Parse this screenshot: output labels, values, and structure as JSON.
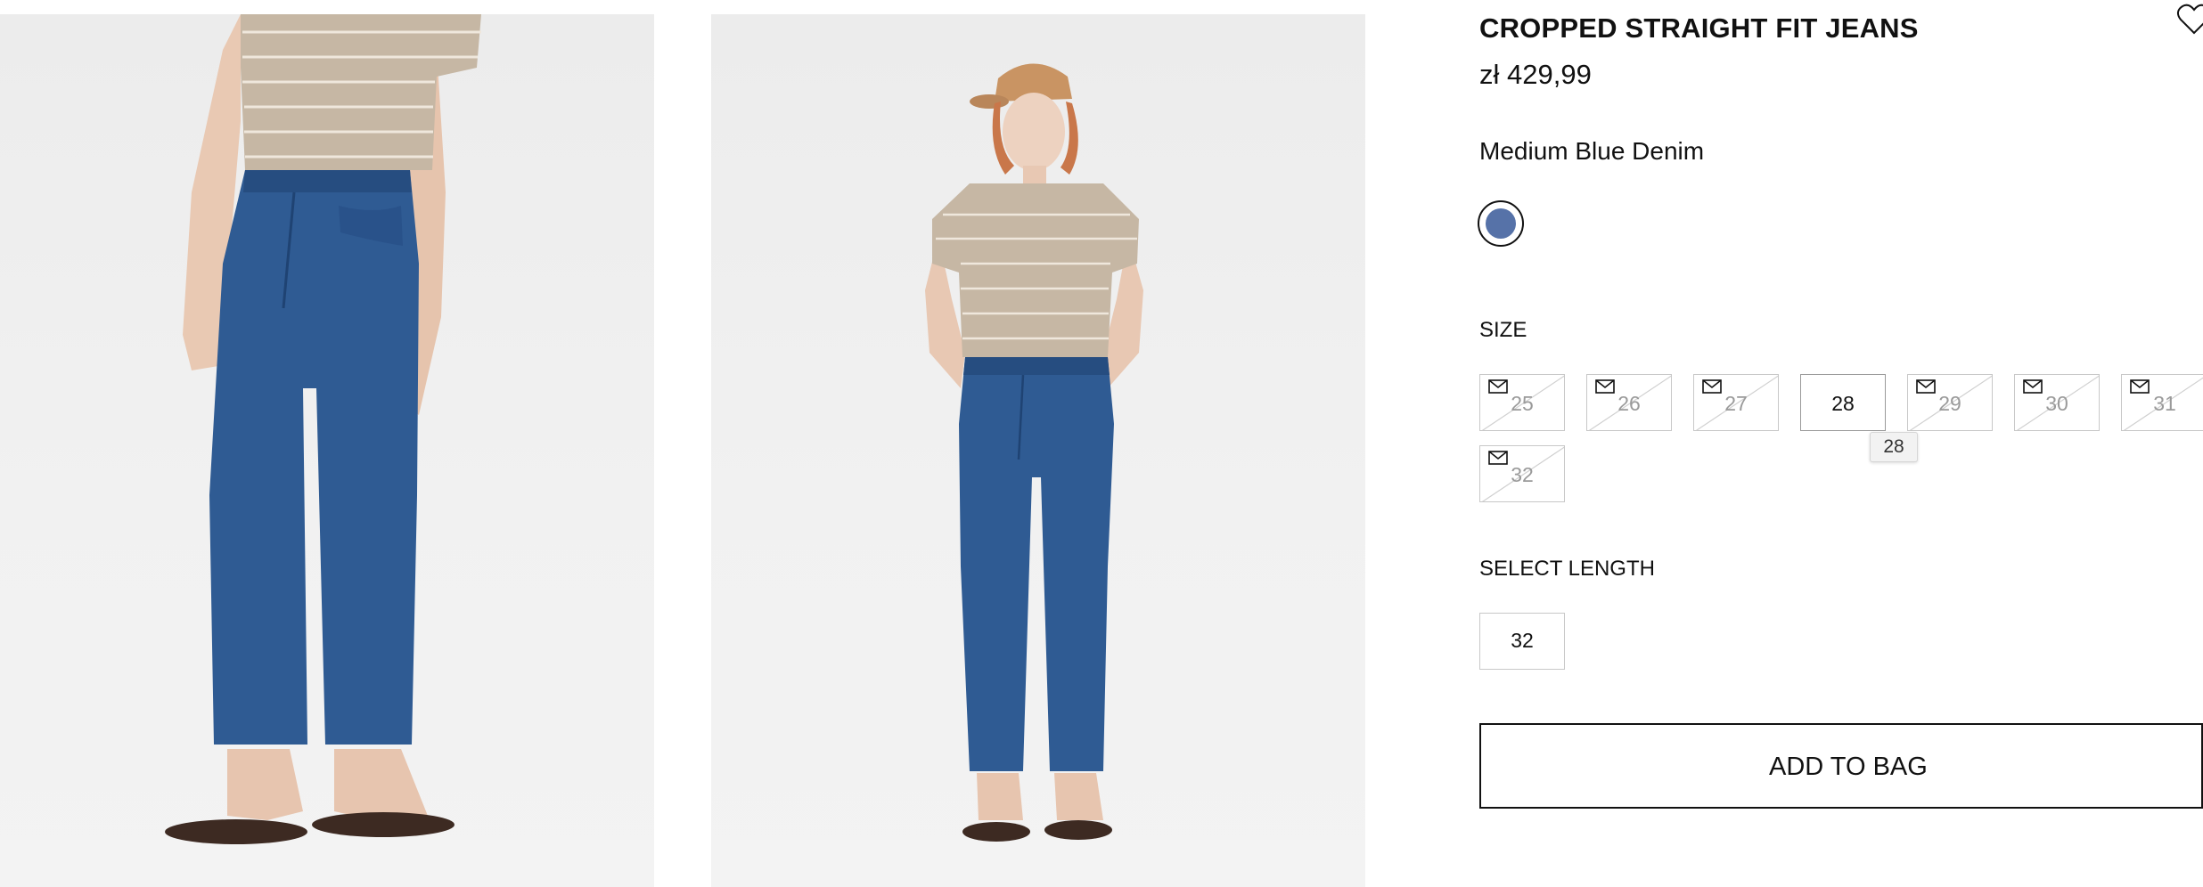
{
  "product": {
    "title": "CROPPED STRAIGHT FIT JEANS",
    "price": "zł 429,99",
    "color_name": "Medium Blue Denim",
    "swatch_color": "#5672a8"
  },
  "size": {
    "label": "SIZE",
    "options": [
      {
        "value": "25",
        "available": false
      },
      {
        "value": "26",
        "available": false
      },
      {
        "value": "27",
        "available": false
      },
      {
        "value": "28",
        "available": true
      },
      {
        "value": "29",
        "available": false
      },
      {
        "value": "30",
        "available": false
      },
      {
        "value": "31",
        "available": false
      },
      {
        "value": "32",
        "available": false
      }
    ],
    "tooltip": "28"
  },
  "length": {
    "label": "SELECT LENGTH",
    "options": [
      {
        "value": "32"
      }
    ]
  },
  "cart": {
    "add_label": "ADD TO BAG"
  },
  "icons": {
    "wishlist": "heart-icon",
    "notify": "envelope-icon"
  },
  "colors": {
    "denim": "#2f5b93",
    "tshirt": "#c6b7a4",
    "unavailable_text": "#9a9a9a"
  }
}
